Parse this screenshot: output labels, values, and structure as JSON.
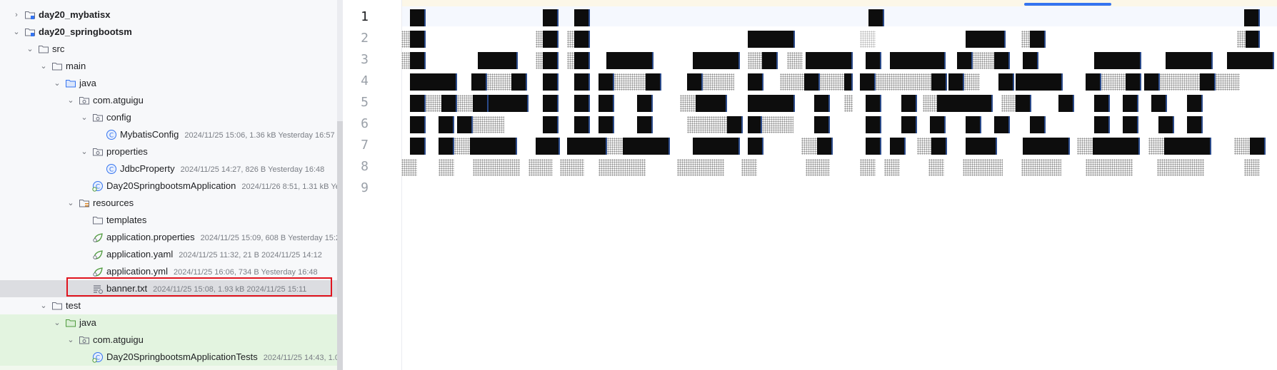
{
  "project_tree": {
    "rows": [
      {
        "label": "day20_mybatisx",
        "meta": "",
        "icon": "module-folder-icon",
        "expanded": false
      },
      {
        "label": "day20_springbootsm",
        "meta": "",
        "icon": "module-folder-icon",
        "expanded": true
      },
      {
        "label": "src",
        "meta": "",
        "icon": "folder-icon",
        "expanded": true
      },
      {
        "label": "main",
        "meta": "",
        "icon": "folder-icon",
        "expanded": true
      },
      {
        "label": "java",
        "meta": "",
        "icon": "source-root-folder-icon",
        "expanded": true
      },
      {
        "label": "com.atguigu",
        "meta": "",
        "icon": "package-icon",
        "expanded": true
      },
      {
        "label": "config",
        "meta": "",
        "icon": "package-icon",
        "expanded": true
      },
      {
        "label": "MybatisConfig",
        "meta": "2024/11/25 15:06, 1.36 kB Yesterday 16:57",
        "icon": "java-class-icon"
      },
      {
        "label": "properties",
        "meta": "",
        "icon": "package-icon",
        "expanded": true
      },
      {
        "label": "JdbcProperty",
        "meta": "2024/11/25 14:27, 826 B Yesterday 16:48",
        "icon": "java-class-icon"
      },
      {
        "label": "Day20SpringbootsmApplication",
        "meta": "2024/11/26 8:51, 1.31 kB Ye",
        "icon": "spring-boot-class-icon"
      },
      {
        "label": "resources",
        "meta": "",
        "icon": "resources-folder-icon",
        "expanded": true
      },
      {
        "label": "templates",
        "meta": "",
        "icon": "folder-icon"
      },
      {
        "label": "application.properties",
        "meta": "2024/11/25 15:09, 608 B Yesterday 15:26",
        "icon": "spring-config-icon"
      },
      {
        "label": "application.yaml",
        "meta": "2024/11/25 11:32, 21 B 2024/11/25 14:12",
        "icon": "spring-config-icon"
      },
      {
        "label": "application.yml",
        "meta": "2024/11/25 16:06, 734 B Yesterday 16:48",
        "icon": "spring-config-icon"
      },
      {
        "label": "banner.txt",
        "meta": "2024/11/25 15:08, 1.93 kB 2024/11/25 15:11",
        "icon": "text-file-icon"
      },
      {
        "label": "test",
        "meta": "",
        "icon": "folder-icon",
        "expanded": true
      },
      {
        "label": "java",
        "meta": "",
        "icon": "test-root-folder-icon",
        "expanded": true
      },
      {
        "label": "com.atguigu",
        "meta": "",
        "icon": "package-icon",
        "expanded": true
      },
      {
        "label": "Day20SpringbootsmApplicationTests",
        "meta": "2024/11/25 14:43, 1.0",
        "icon": "spring-boot-class-icon"
      }
    ],
    "selected": "banner.txt"
  },
  "editor": {
    "file": "banner.txt",
    "line_numbers": [
      "1",
      "2",
      "3",
      "4",
      "5",
      "6",
      "7",
      "8",
      "9"
    ],
    "current_line": "1"
  },
  "colors": {
    "tree_bg": "#f7f8fa",
    "test_bg": "#e3f4e0",
    "selection": "#dcdde1",
    "highlight_box": "#e0141e",
    "accent": "#3574f0"
  }
}
